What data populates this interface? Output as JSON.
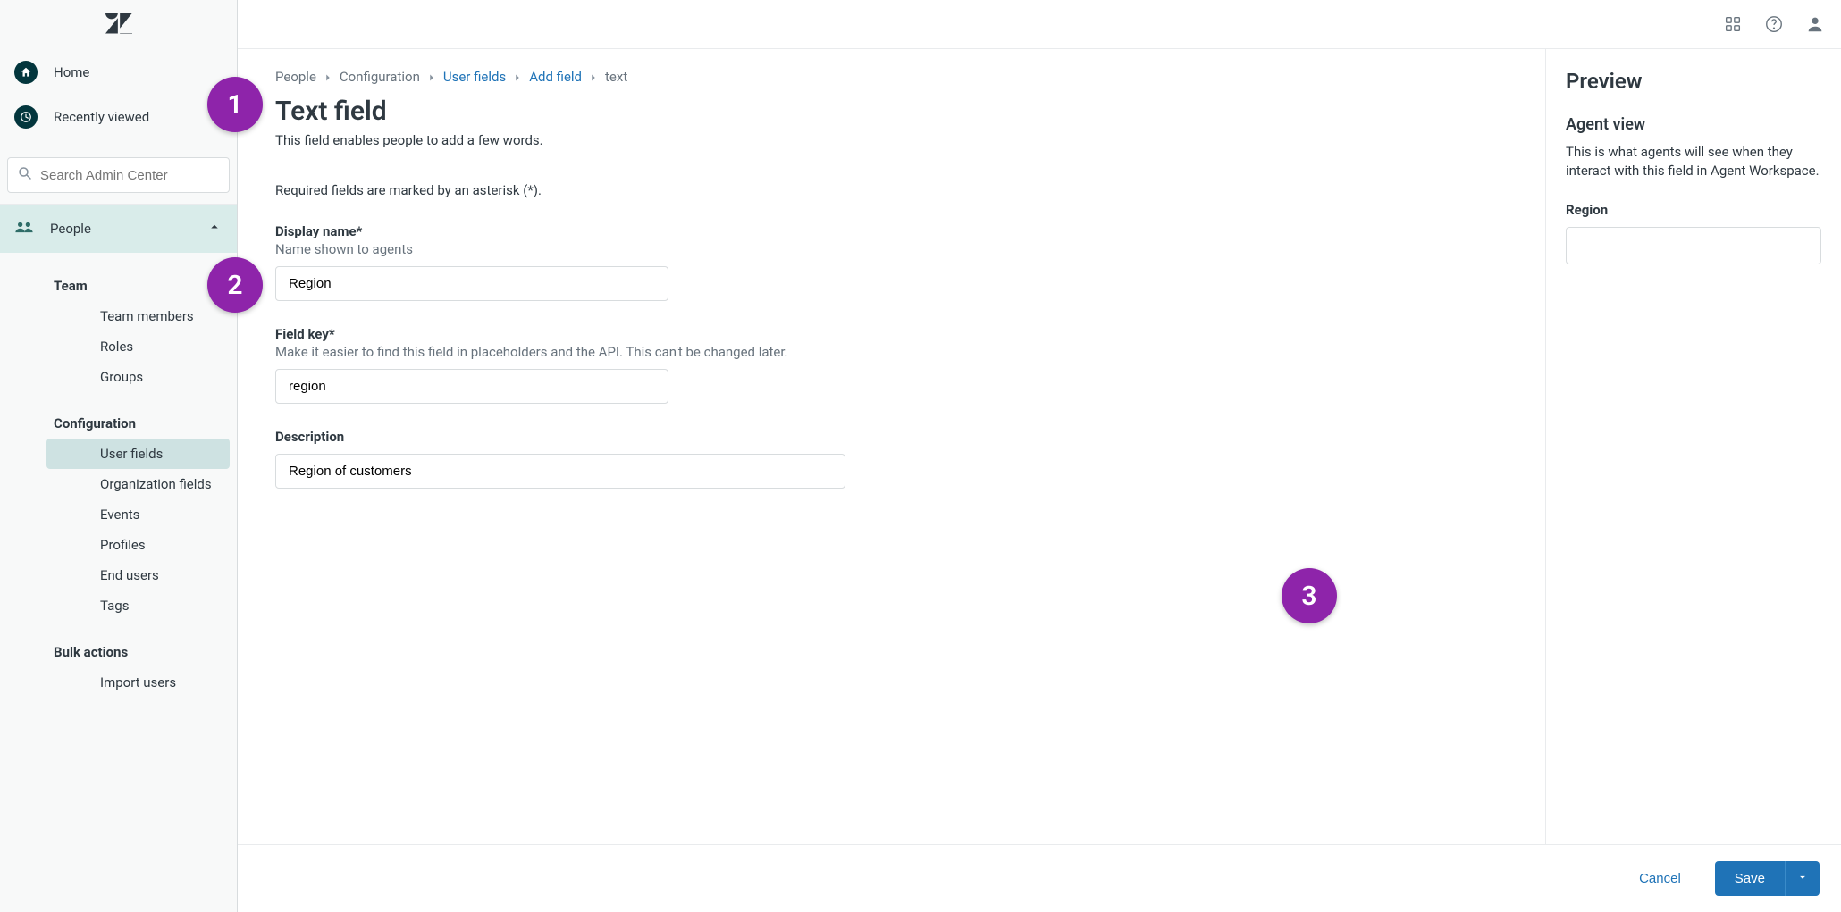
{
  "sidebar": {
    "nav_primary": {
      "home": "Home",
      "recently_viewed": "Recently viewed"
    },
    "search_placeholder": "Search Admin Center",
    "section_label": "People",
    "groups": [
      {
        "title": "Team",
        "links": [
          {
            "label": "Team members",
            "active": false
          },
          {
            "label": "Roles",
            "active": false
          },
          {
            "label": "Groups",
            "active": false
          }
        ]
      },
      {
        "title": "Configuration",
        "links": [
          {
            "label": "User fields",
            "active": true
          },
          {
            "label": "Organization fields",
            "active": false
          },
          {
            "label": "Events",
            "active": false
          },
          {
            "label": "Profiles",
            "active": false
          },
          {
            "label": "End users",
            "active": false
          },
          {
            "label": "Tags",
            "active": false
          }
        ]
      },
      {
        "title": "Bulk actions",
        "links": [
          {
            "label": "Import users",
            "active": false
          }
        ]
      }
    ]
  },
  "breadcrumb": {
    "items": [
      {
        "label": "People",
        "link": false
      },
      {
        "label": "Configuration",
        "link": false
      },
      {
        "label": "User fields",
        "link": true
      },
      {
        "label": "Add field",
        "link": true
      },
      {
        "label": "text",
        "link": false
      }
    ]
  },
  "page": {
    "title": "Text field",
    "subtitle": "This field enables people to add a few words.",
    "required_note": "Required fields are marked by an asterisk (*)."
  },
  "form": {
    "display_name": {
      "label": "Display name*",
      "hint": "Name shown to agents",
      "value": "Region"
    },
    "field_key": {
      "label": "Field key*",
      "hint": "Make it easier to find this field in placeholders and the API. This can't be changed later.",
      "value": "region"
    },
    "description": {
      "label": "Description",
      "value": "Region of customers"
    }
  },
  "preview": {
    "title": "Preview",
    "subtitle": "Agent view",
    "blurb": "This is what agents will see when they interact with this field in Agent Workspace.",
    "field_label": "Region"
  },
  "footer": {
    "cancel": "Cancel",
    "save": "Save"
  },
  "annotations": {
    "step1": "1",
    "step2": "2",
    "step3": "3"
  },
  "colors": {
    "brand_dark": "#03363d",
    "accent_blue": "#1f73b7",
    "annotation_purple": "#8e24aa",
    "sidebar_section_bg": "#d9ecea"
  }
}
